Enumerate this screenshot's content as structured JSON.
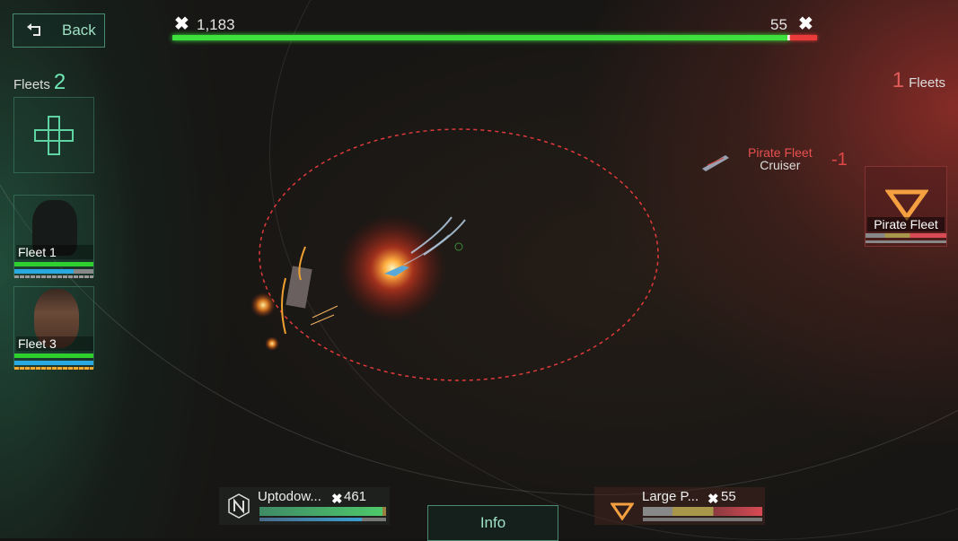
{
  "header": {
    "back_label": "Back",
    "player_score": "1,183",
    "enemy_score": "55",
    "player_power_fraction": 0.956,
    "colors": {
      "player": "#3ee03e",
      "enemy": "#ea3b3b",
      "accent": "#6fe8b6"
    }
  },
  "left_fleets": {
    "label": "Fleets",
    "count": "2",
    "add_icon": "plus-icon",
    "cards": [
      {
        "name": "Fleet 1",
        "portrait": "silhouette",
        "hp_fraction": 0.97,
        "shield_fraction": 0.75
      },
      {
        "name": "Fleet 3",
        "portrait": "commander-face",
        "hp_fraction": 1.0,
        "shield_fraction": 1.0
      }
    ]
  },
  "right_fleets": {
    "label": "Fleets",
    "count": "1",
    "card": {
      "name": "Pirate Fleet",
      "icon": "triangle-down-icon"
    }
  },
  "battle": {
    "enemy_label_faction": "Pirate Fleet",
    "enemy_label_type": "Cruiser",
    "enemy_damage": "-1"
  },
  "bottom": {
    "player_unit": {
      "name": "Uptodow...",
      "power": "461",
      "icon": "hexagon-n-icon",
      "hp_fraction": 0.97,
      "shield_fraction": 0.82
    },
    "info_label": "Info",
    "enemy_unit": {
      "name": "Large P...",
      "power": "55",
      "icon": "triangle-down-icon"
    }
  }
}
